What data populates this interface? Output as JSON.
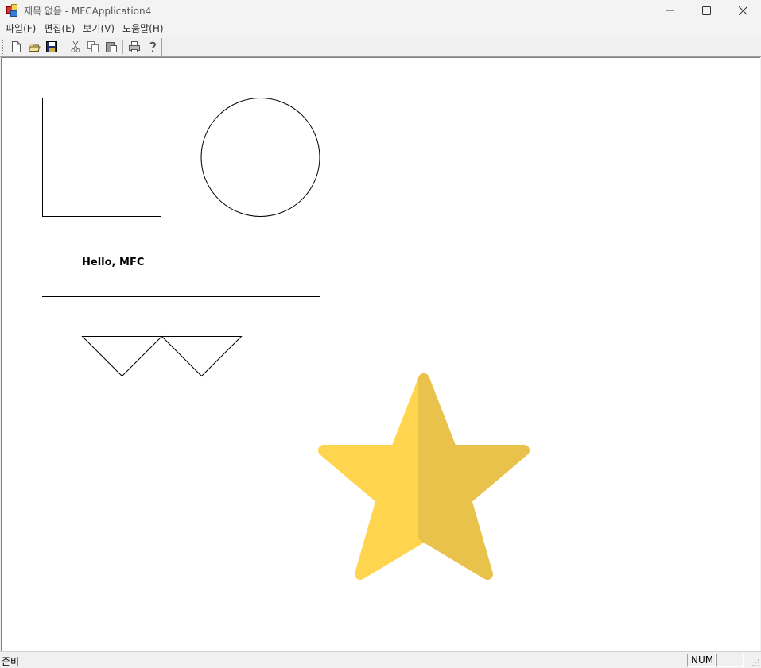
{
  "window": {
    "title": "제목 없음 - MFCApplication4",
    "controls": [
      "minimize-icon",
      "maximize-icon",
      "close-icon"
    ]
  },
  "menu": {
    "items": [
      {
        "label": "파일(F)"
      },
      {
        "label": "편집(E)"
      },
      {
        "label": "보기(V)"
      },
      {
        "label": "도움말(H)"
      }
    ]
  },
  "toolbar": {
    "buttons": [
      "new-icon",
      "open-icon",
      "save-icon",
      "cut-icon",
      "copy-icon",
      "paste-icon",
      "print-icon",
      "help-icon"
    ]
  },
  "canvas": {
    "text": "Hello, MFC",
    "star_colors": {
      "left": "#FFD44F",
      "right": "#E8C24A"
    }
  },
  "statusbar": {
    "status": "준비",
    "indicator": "NUM"
  }
}
